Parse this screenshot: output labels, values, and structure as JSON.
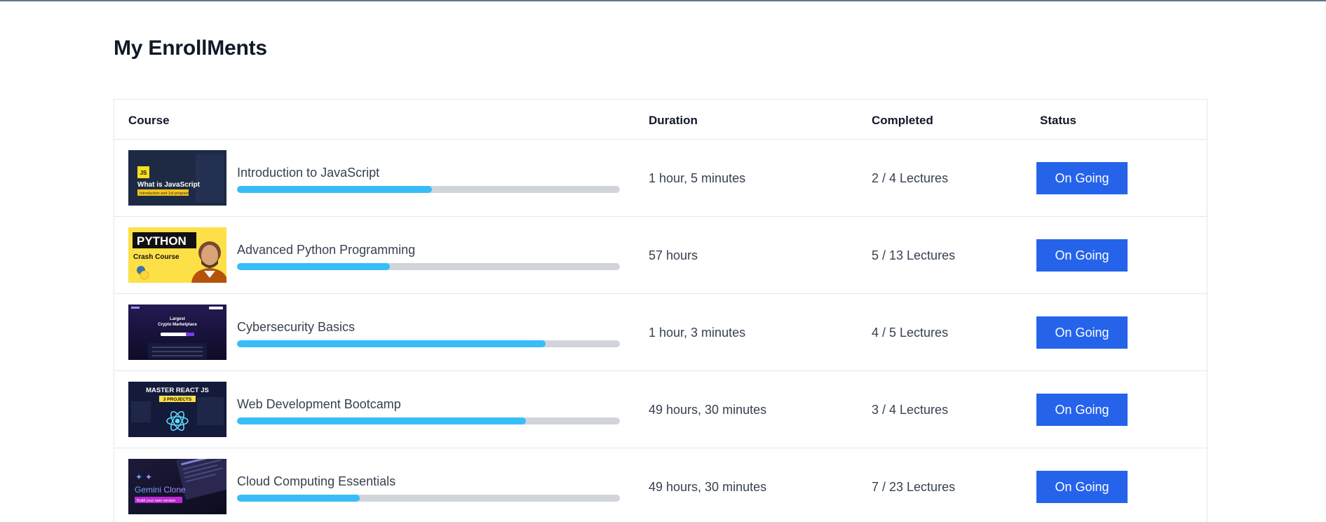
{
  "page_title": "My EnrollMents",
  "columns": {
    "course": "Course",
    "duration": "Duration",
    "completed": "Completed",
    "status": "Status"
  },
  "rows": [
    {
      "title": "Introduction to JavaScript",
      "progress": 0.51,
      "duration": "1 hour, 5 minutes",
      "completed": "2 / 4 Lectures",
      "status": "On Going",
      "thumb": {
        "badge": "JS",
        "heading": "What is JavaScript",
        "strip": "Introduction and 1st program"
      }
    },
    {
      "title": "Advanced Python Programming",
      "progress": 0.4,
      "duration": "57 hours",
      "completed": "5 / 13 Lectures",
      "status": "On Going",
      "thumb": {
        "heading": "PYTHON",
        "sub": "Crash Course"
      }
    },
    {
      "title": "Cybersecurity Basics",
      "progress": 0.805,
      "duration": "1 hour, 3 minutes",
      "completed": "4 / 5 Lectures",
      "status": "On Going",
      "thumb": {
        "heading": "Largest",
        "sub": "Crypto Marketplace"
      }
    },
    {
      "title": "Web Development Bootcamp",
      "progress": 0.755,
      "duration": "49 hours, 30 minutes",
      "completed": "3 / 4 Lectures",
      "status": "On Going",
      "thumb": {
        "heading": "MASTER REACT JS",
        "sub": "3 PROJECTS"
      }
    },
    {
      "title": "Cloud Computing Essentials",
      "progress": 0.32,
      "duration": "49 hours, 30 minutes",
      "completed": "7 / 23 Lectures",
      "status": "On Going",
      "thumb": {
        "heading": "Gemini Clone",
        "sub": "Build your own version"
      }
    }
  ],
  "colors": {
    "accent": "#2563eb",
    "progress_fill": "#38bdf8",
    "progress_track": "#d1d5db"
  }
}
